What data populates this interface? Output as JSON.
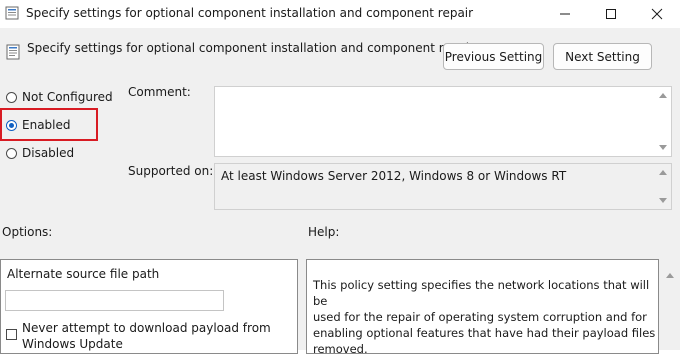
{
  "window": {
    "title": "Specify settings for optional component installation and component repair"
  },
  "header": {
    "setting_name": "Specify settings for optional component installation and component repair",
    "previous_label": "Previous Setting",
    "next_label": "Next Setting"
  },
  "state": {
    "options": [
      "Not Configured",
      "Enabled",
      "Disabled"
    ],
    "selected": "Enabled"
  },
  "comment": {
    "label": "Comment:",
    "value": ""
  },
  "supported": {
    "label": "Supported on:",
    "value": "At least Windows Server 2012, Windows 8 or Windows RT"
  },
  "options_section": {
    "label": "Options:",
    "alt_source_label": "Alternate source file path",
    "alt_source_value": "",
    "never_download_label_line1": "Never attempt to download payload from",
    "never_download_label_line2": "Windows Update",
    "never_download_checked": false
  },
  "help_section": {
    "label": "Help:",
    "lines": [
      "This policy setting specifies the network locations that will be",
      "used for the repair of operating system corruption and for",
      "enabling optional features that have had their payload files",
      "removed."
    ]
  },
  "colors": {
    "accent": "#0f5fc2",
    "highlight": "#d81b23",
    "dialog_bg": "#f0f0f0"
  },
  "icons": [
    "policy-icon",
    "minimize-icon",
    "maximize-icon",
    "close-icon"
  ]
}
